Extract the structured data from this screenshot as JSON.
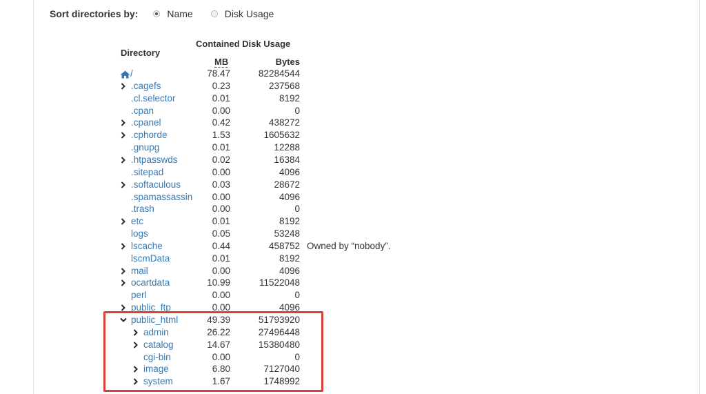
{
  "sort": {
    "label": "Sort directories by:",
    "options": [
      {
        "label": "Name",
        "checked": true
      },
      {
        "label": "Disk Usage",
        "checked": false
      }
    ]
  },
  "table": {
    "directory_header": "Directory",
    "usage_header": "Contained Disk Usage",
    "mb_header": "MB",
    "bytes_header": "Bytes",
    "rows": [
      {
        "name": "/",
        "mb": "78.47",
        "bytes": "82284544",
        "level": 0,
        "expander": "none",
        "home": true
      },
      {
        "name": ".cagefs",
        "mb": "0.23",
        "bytes": "237568",
        "level": 0,
        "expander": "collapsed"
      },
      {
        "name": ".cl.selector",
        "mb": "0.01",
        "bytes": "8192",
        "level": 0,
        "expander": "none"
      },
      {
        "name": ".cpan",
        "mb": "0.00",
        "bytes": "0",
        "level": 0,
        "expander": "none"
      },
      {
        "name": ".cpanel",
        "mb": "0.42",
        "bytes": "438272",
        "level": 0,
        "expander": "collapsed"
      },
      {
        "name": ".cphorde",
        "mb": "1.53",
        "bytes": "1605632",
        "level": 0,
        "expander": "collapsed"
      },
      {
        "name": ".gnupg",
        "mb": "0.01",
        "bytes": "12288",
        "level": 0,
        "expander": "none"
      },
      {
        "name": ".htpasswds",
        "mb": "0.02",
        "bytes": "16384",
        "level": 0,
        "expander": "collapsed"
      },
      {
        "name": ".sitepad",
        "mb": "0.00",
        "bytes": "4096",
        "level": 0,
        "expander": "none"
      },
      {
        "name": ".softaculous",
        "mb": "0.03",
        "bytes": "28672",
        "level": 0,
        "expander": "collapsed"
      },
      {
        "name": ".spamassassin",
        "mb": "0.00",
        "bytes": "4096",
        "level": 0,
        "expander": "none"
      },
      {
        "name": ".trash",
        "mb": "0.00",
        "bytes": "0",
        "level": 0,
        "expander": "none"
      },
      {
        "name": "etc",
        "mb": "0.01",
        "bytes": "8192",
        "level": 0,
        "expander": "collapsed"
      },
      {
        "name": "logs",
        "mb": "0.05",
        "bytes": "53248",
        "level": 0,
        "expander": "none"
      },
      {
        "name": "lscache",
        "mb": "0.44",
        "bytes": "458752",
        "level": 0,
        "expander": "collapsed",
        "note": "Owned by “nobody”."
      },
      {
        "name": "lscmData",
        "mb": "0.01",
        "bytes": "8192",
        "level": 0,
        "expander": "none"
      },
      {
        "name": "mail",
        "mb": "0.00",
        "bytes": "4096",
        "level": 0,
        "expander": "collapsed"
      },
      {
        "name": "ocartdata",
        "mb": "10.99",
        "bytes": "11522048",
        "level": 0,
        "expander": "collapsed"
      },
      {
        "name": "perl",
        "mb": "0.00",
        "bytes": "0",
        "level": 0,
        "expander": "none"
      },
      {
        "name": "public_ftp",
        "mb": "0.00",
        "bytes": "4096",
        "level": 0,
        "expander": "collapsed"
      },
      {
        "name": "public_html",
        "mb": "49.39",
        "bytes": "51793920",
        "level": 0,
        "expander": "expanded"
      },
      {
        "name": "admin",
        "mb": "26.22",
        "bytes": "27496448",
        "level": 1,
        "expander": "collapsed"
      },
      {
        "name": "catalog",
        "mb": "14.67",
        "bytes": "15380480",
        "level": 1,
        "expander": "collapsed"
      },
      {
        "name": "cgi-bin",
        "mb": "0.00",
        "bytes": "0",
        "level": 1,
        "expander": "none"
      },
      {
        "name": "image",
        "mb": "6.80",
        "bytes": "7127040",
        "level": 1,
        "expander": "collapsed"
      },
      {
        "name": "system",
        "mb": "1.67",
        "bytes": "1748992",
        "level": 1,
        "expander": "collapsed"
      }
    ]
  },
  "colors": {
    "link": "#337ab7",
    "highlight": "#d9403a"
  }
}
